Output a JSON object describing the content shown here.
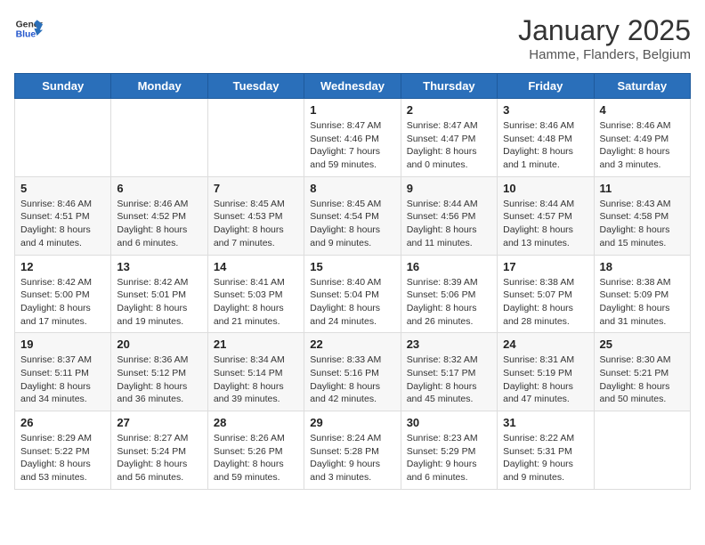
{
  "header": {
    "logo_general": "General",
    "logo_blue": "Blue",
    "month": "January 2025",
    "location": "Hamme, Flanders, Belgium"
  },
  "weekdays": [
    "Sunday",
    "Monday",
    "Tuesday",
    "Wednesday",
    "Thursday",
    "Friday",
    "Saturday"
  ],
  "weeks": [
    [
      {
        "day": "",
        "info": ""
      },
      {
        "day": "",
        "info": ""
      },
      {
        "day": "",
        "info": ""
      },
      {
        "day": "1",
        "info": "Sunrise: 8:47 AM\nSunset: 4:46 PM\nDaylight: 7 hours and 59 minutes."
      },
      {
        "day": "2",
        "info": "Sunrise: 8:47 AM\nSunset: 4:47 PM\nDaylight: 8 hours and 0 minutes."
      },
      {
        "day": "3",
        "info": "Sunrise: 8:46 AM\nSunset: 4:48 PM\nDaylight: 8 hours and 1 minute."
      },
      {
        "day": "4",
        "info": "Sunrise: 8:46 AM\nSunset: 4:49 PM\nDaylight: 8 hours and 3 minutes."
      }
    ],
    [
      {
        "day": "5",
        "info": "Sunrise: 8:46 AM\nSunset: 4:51 PM\nDaylight: 8 hours and 4 minutes."
      },
      {
        "day": "6",
        "info": "Sunrise: 8:46 AM\nSunset: 4:52 PM\nDaylight: 8 hours and 6 minutes."
      },
      {
        "day": "7",
        "info": "Sunrise: 8:45 AM\nSunset: 4:53 PM\nDaylight: 8 hours and 7 minutes."
      },
      {
        "day": "8",
        "info": "Sunrise: 8:45 AM\nSunset: 4:54 PM\nDaylight: 8 hours and 9 minutes."
      },
      {
        "day": "9",
        "info": "Sunrise: 8:44 AM\nSunset: 4:56 PM\nDaylight: 8 hours and 11 minutes."
      },
      {
        "day": "10",
        "info": "Sunrise: 8:44 AM\nSunset: 4:57 PM\nDaylight: 8 hours and 13 minutes."
      },
      {
        "day": "11",
        "info": "Sunrise: 8:43 AM\nSunset: 4:58 PM\nDaylight: 8 hours and 15 minutes."
      }
    ],
    [
      {
        "day": "12",
        "info": "Sunrise: 8:42 AM\nSunset: 5:00 PM\nDaylight: 8 hours and 17 minutes."
      },
      {
        "day": "13",
        "info": "Sunrise: 8:42 AM\nSunset: 5:01 PM\nDaylight: 8 hours and 19 minutes."
      },
      {
        "day": "14",
        "info": "Sunrise: 8:41 AM\nSunset: 5:03 PM\nDaylight: 8 hours and 21 minutes."
      },
      {
        "day": "15",
        "info": "Sunrise: 8:40 AM\nSunset: 5:04 PM\nDaylight: 8 hours and 24 minutes."
      },
      {
        "day": "16",
        "info": "Sunrise: 8:39 AM\nSunset: 5:06 PM\nDaylight: 8 hours and 26 minutes."
      },
      {
        "day": "17",
        "info": "Sunrise: 8:38 AM\nSunset: 5:07 PM\nDaylight: 8 hours and 28 minutes."
      },
      {
        "day": "18",
        "info": "Sunrise: 8:38 AM\nSunset: 5:09 PM\nDaylight: 8 hours and 31 minutes."
      }
    ],
    [
      {
        "day": "19",
        "info": "Sunrise: 8:37 AM\nSunset: 5:11 PM\nDaylight: 8 hours and 34 minutes."
      },
      {
        "day": "20",
        "info": "Sunrise: 8:36 AM\nSunset: 5:12 PM\nDaylight: 8 hours and 36 minutes."
      },
      {
        "day": "21",
        "info": "Sunrise: 8:34 AM\nSunset: 5:14 PM\nDaylight: 8 hours and 39 minutes."
      },
      {
        "day": "22",
        "info": "Sunrise: 8:33 AM\nSunset: 5:16 PM\nDaylight: 8 hours and 42 minutes."
      },
      {
        "day": "23",
        "info": "Sunrise: 8:32 AM\nSunset: 5:17 PM\nDaylight: 8 hours and 45 minutes."
      },
      {
        "day": "24",
        "info": "Sunrise: 8:31 AM\nSunset: 5:19 PM\nDaylight: 8 hours and 47 minutes."
      },
      {
        "day": "25",
        "info": "Sunrise: 8:30 AM\nSunset: 5:21 PM\nDaylight: 8 hours and 50 minutes."
      }
    ],
    [
      {
        "day": "26",
        "info": "Sunrise: 8:29 AM\nSunset: 5:22 PM\nDaylight: 8 hours and 53 minutes."
      },
      {
        "day": "27",
        "info": "Sunrise: 8:27 AM\nSunset: 5:24 PM\nDaylight: 8 hours and 56 minutes."
      },
      {
        "day": "28",
        "info": "Sunrise: 8:26 AM\nSunset: 5:26 PM\nDaylight: 8 hours and 59 minutes."
      },
      {
        "day": "29",
        "info": "Sunrise: 8:24 AM\nSunset: 5:28 PM\nDaylight: 9 hours and 3 minutes."
      },
      {
        "day": "30",
        "info": "Sunrise: 8:23 AM\nSunset: 5:29 PM\nDaylight: 9 hours and 6 minutes."
      },
      {
        "day": "31",
        "info": "Sunrise: 8:22 AM\nSunset: 5:31 PM\nDaylight: 9 hours and 9 minutes."
      },
      {
        "day": "",
        "info": ""
      }
    ]
  ]
}
